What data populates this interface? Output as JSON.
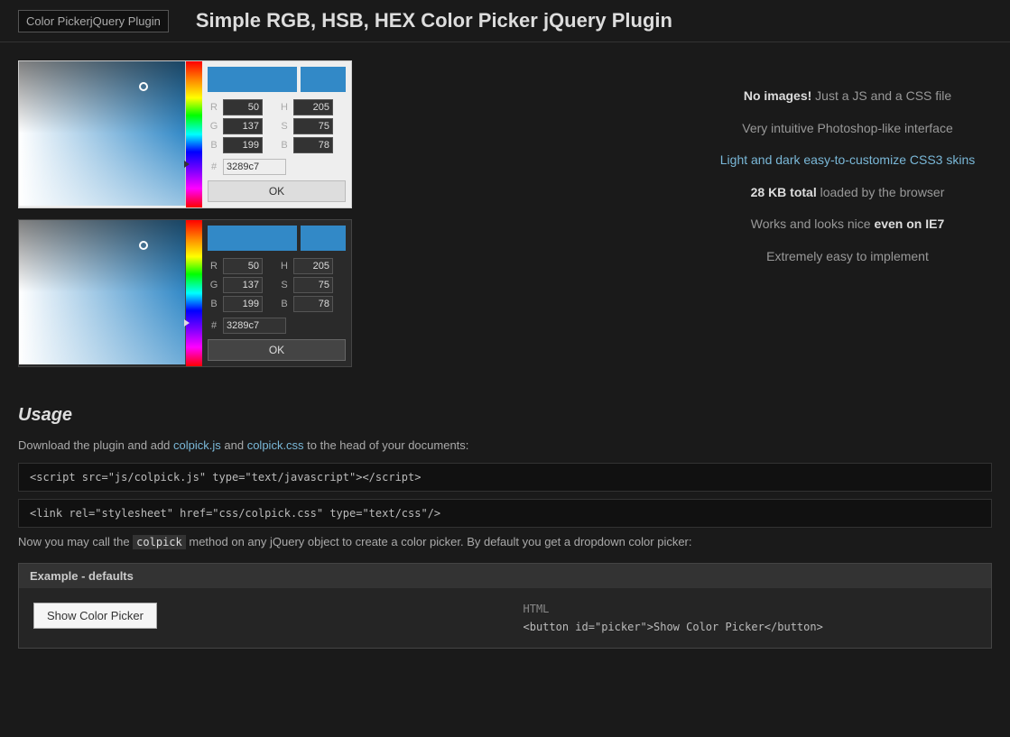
{
  "header": {
    "logo_text": "Color PickerjQuery Plugin",
    "title": "Simple RGB, HSB, HEX Color Picker jQuery Plugin"
  },
  "picker1": {
    "r": "50",
    "g": "137",
    "b": "199",
    "h": "205",
    "s": "75",
    "b2": "78",
    "hex": "3289c7",
    "ok_label": "OK"
  },
  "picker2": {
    "r": "50",
    "g": "137",
    "b": "199",
    "h": "205",
    "s": "75",
    "b2": "78",
    "hex": "3289c7",
    "ok_label": "OK"
  },
  "features": [
    {
      "id": "no-images",
      "text_before": "",
      "strong": "No images!",
      "text_after": " Just a JS and a CSS file"
    },
    {
      "id": "intuitive",
      "text_before": "Very intuitive Photoshop-like interface",
      "strong": "",
      "text_after": ""
    },
    {
      "id": "skins",
      "text_before": "Light and dark easy-to-customize CSS3 skins",
      "strong": "",
      "text_after": ""
    },
    {
      "id": "size",
      "text_before": "",
      "strong": "28 KB total",
      "text_after": " loaded by the browser"
    },
    {
      "id": "ie7",
      "text_before": "Works and looks nice ",
      "strong": "even on IE7",
      "text_after": ""
    },
    {
      "id": "easy",
      "text_before": "Extremely easy to implement",
      "strong": "",
      "text_after": ""
    }
  ],
  "usage": {
    "title": "Usage",
    "desc_before": "Download the plugin and add ",
    "link1": "colpick.js",
    "desc_mid": " and ",
    "link2": "colpick.css",
    "desc_after": " to the head of your documents:",
    "code1": "<script src=\"js/colpick.js\" type=\"text/javascript\"></script>",
    "code2": "<link rel=\"stylesheet\" href=\"css/colpick.css\" type=\"text/css\"/>",
    "note_before": "Now you may call the ",
    "code_inline": "colpick",
    "note_after": " method on any jQuery object to create a color picker. By default you get a dropdown color picker:",
    "example_header": "Example - defaults",
    "show_picker_btn": "Show Color Picker",
    "html_label": "HTML",
    "html_code": "<button id=\"picker\">Show Color Picker</button>"
  }
}
